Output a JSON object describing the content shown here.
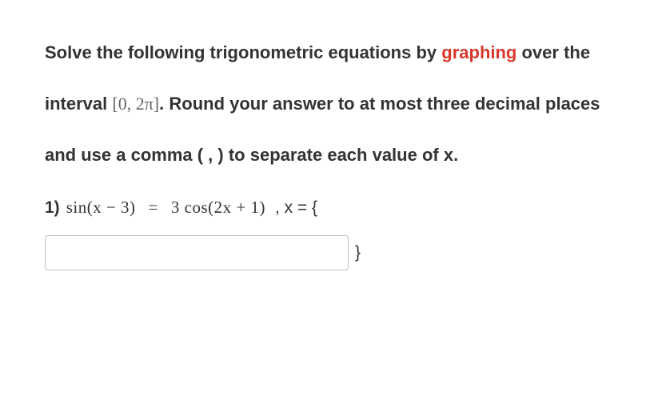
{
  "instructions": {
    "part1": "Solve the following trigonometric equations by ",
    "highlight": "graphing",
    "part2": " over the interval ",
    "interval": "[0, 2π]",
    "part3": ". Round your answer to at most three decimal places and use a comma ( , ) to separate each value of x."
  },
  "question": {
    "number": "1)",
    "equation_lhs": "sin(x − 3)",
    "equals": "=",
    "equation_rhs": "3 cos(2x + 1)",
    "suffix": ", x = {"
  },
  "answer": {
    "value": "",
    "placeholder": "",
    "close_brace": "}"
  }
}
